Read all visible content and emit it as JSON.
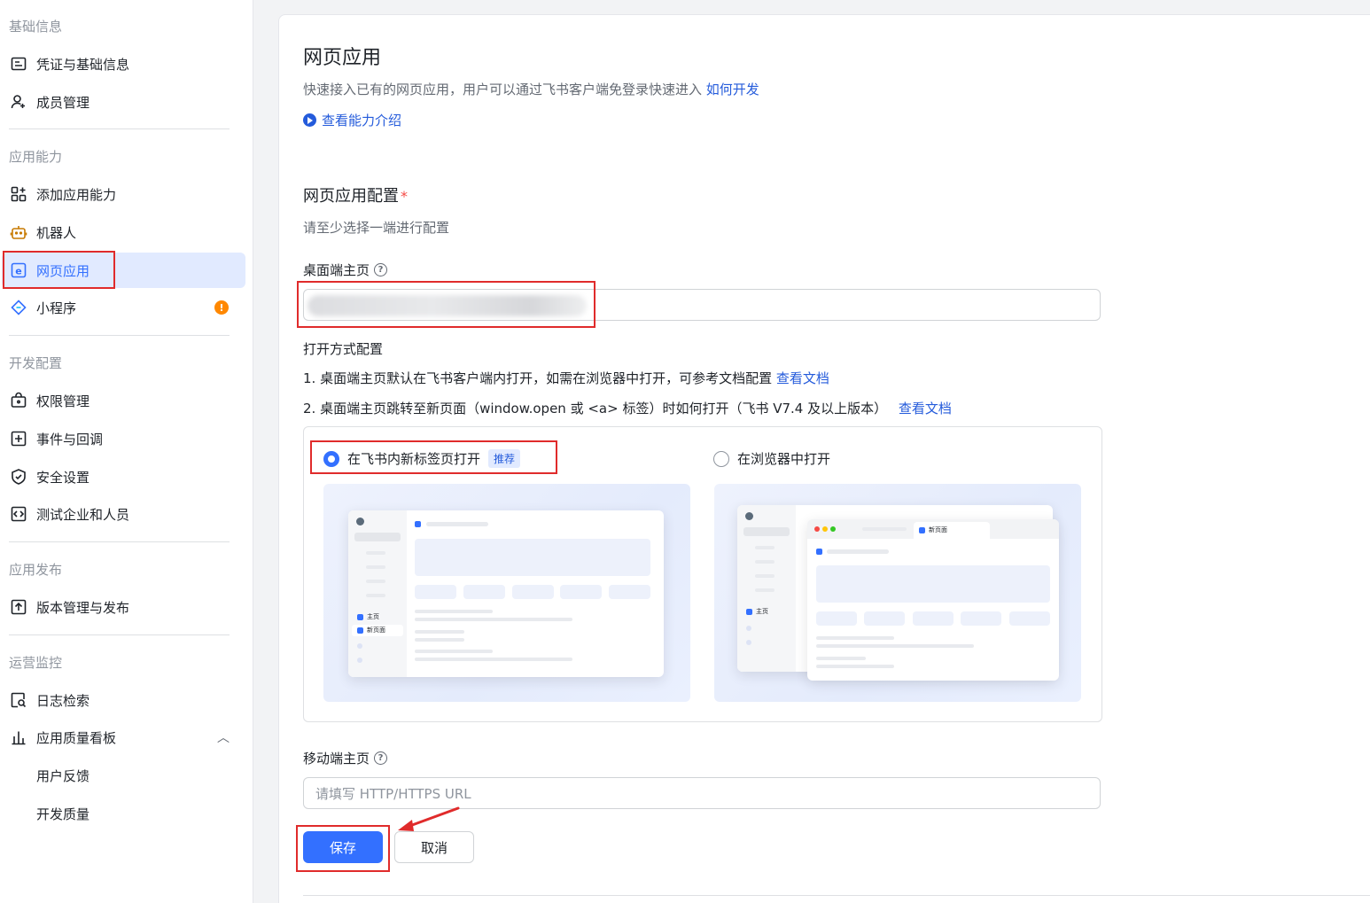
{
  "sidebar": {
    "groups": [
      {
        "title": "基础信息",
        "items": [
          {
            "label": "凭证与基础信息",
            "icon": "id-card-icon"
          },
          {
            "label": "成员管理",
            "icon": "user-add-icon"
          }
        ]
      },
      {
        "title": "应用能力",
        "items": [
          {
            "label": "添加应用能力",
            "icon": "apps-add-icon"
          },
          {
            "label": "机器人",
            "icon": "robot-icon"
          },
          {
            "label": "网页应用",
            "icon": "web-app-icon",
            "active": true
          },
          {
            "label": "小程序",
            "icon": "mini-program-icon",
            "badge": "!"
          }
        ]
      },
      {
        "title": "开发配置",
        "items": [
          {
            "label": "权限管理",
            "icon": "permission-icon"
          },
          {
            "label": "事件与回调",
            "icon": "event-icon"
          },
          {
            "label": "安全设置",
            "icon": "shield-icon"
          },
          {
            "label": "测试企业和人员",
            "icon": "code-icon"
          }
        ]
      },
      {
        "title": "应用发布",
        "items": [
          {
            "label": "版本管理与发布",
            "icon": "upload-icon"
          }
        ]
      },
      {
        "title": "运营监控",
        "items": [
          {
            "label": "日志检索",
            "icon": "log-search-icon"
          },
          {
            "label": "应用质量看板",
            "icon": "bar-chart-icon",
            "expanded": true
          },
          {
            "label": "用户反馈"
          },
          {
            "label": "开发质量"
          }
        ]
      }
    ]
  },
  "main": {
    "title": "网页应用",
    "description": "快速接入已有的网页应用，用户可以通过飞书客户端免登录快速进入",
    "how_to_link": "如何开发",
    "intro_link": "查看能力介绍",
    "config_title": "网页应用配置",
    "config_required_mark": "*",
    "config_hint": "请至少选择一端进行配置",
    "desktop_label": "桌面端主页",
    "desktop_value": "",
    "open_mode_title": "打开方式配置",
    "open_mode_line1": "1. 桌面端主页默认在飞书客户端内打开，如需在浏览器中打开，可参考文档配置",
    "open_mode_line2": "2. 桌面端主页跳转至新页面（window.open 或 <a> 标签）时如何打开（飞书 V7.4 及以上版本）",
    "doc_link": "查看文档",
    "options": [
      {
        "label": "在飞书内新标签页打开",
        "tag": "推荐",
        "selected": true
      },
      {
        "label": "在浏览器中打开",
        "selected": false
      }
    ],
    "preview_texts": {
      "home": "主页",
      "new_page": "新页面"
    },
    "mobile_label": "移动端主页",
    "mobile_placeholder": "请填写 HTTP/HTTPS URL",
    "save_label": "保存",
    "cancel_label": "取消",
    "help_glyph": "?"
  },
  "colors": {
    "accent": "#3370ff",
    "highlight": "#e02b2b",
    "warning": "#ff8800"
  }
}
